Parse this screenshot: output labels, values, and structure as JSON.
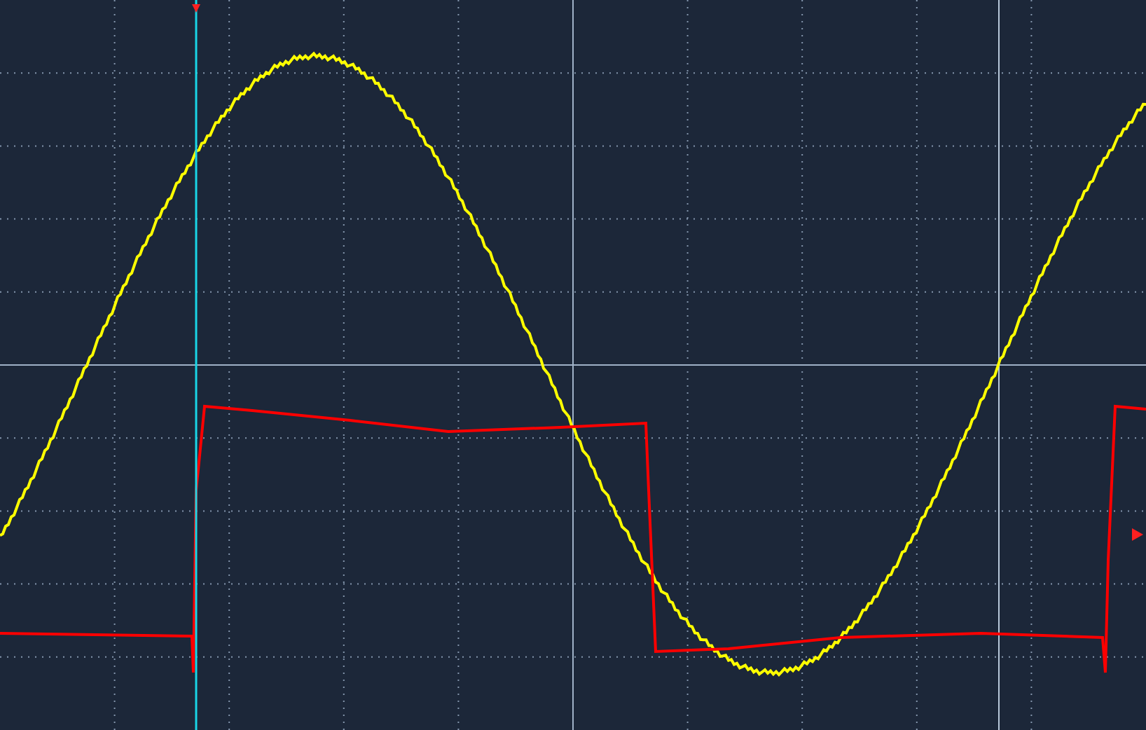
{
  "scope": {
    "traces": [
      {
        "kind": "sine",
        "color": "#ffff00"
      },
      {
        "kind": "square",
        "color": "#ff0000"
      }
    ]
  }
}
